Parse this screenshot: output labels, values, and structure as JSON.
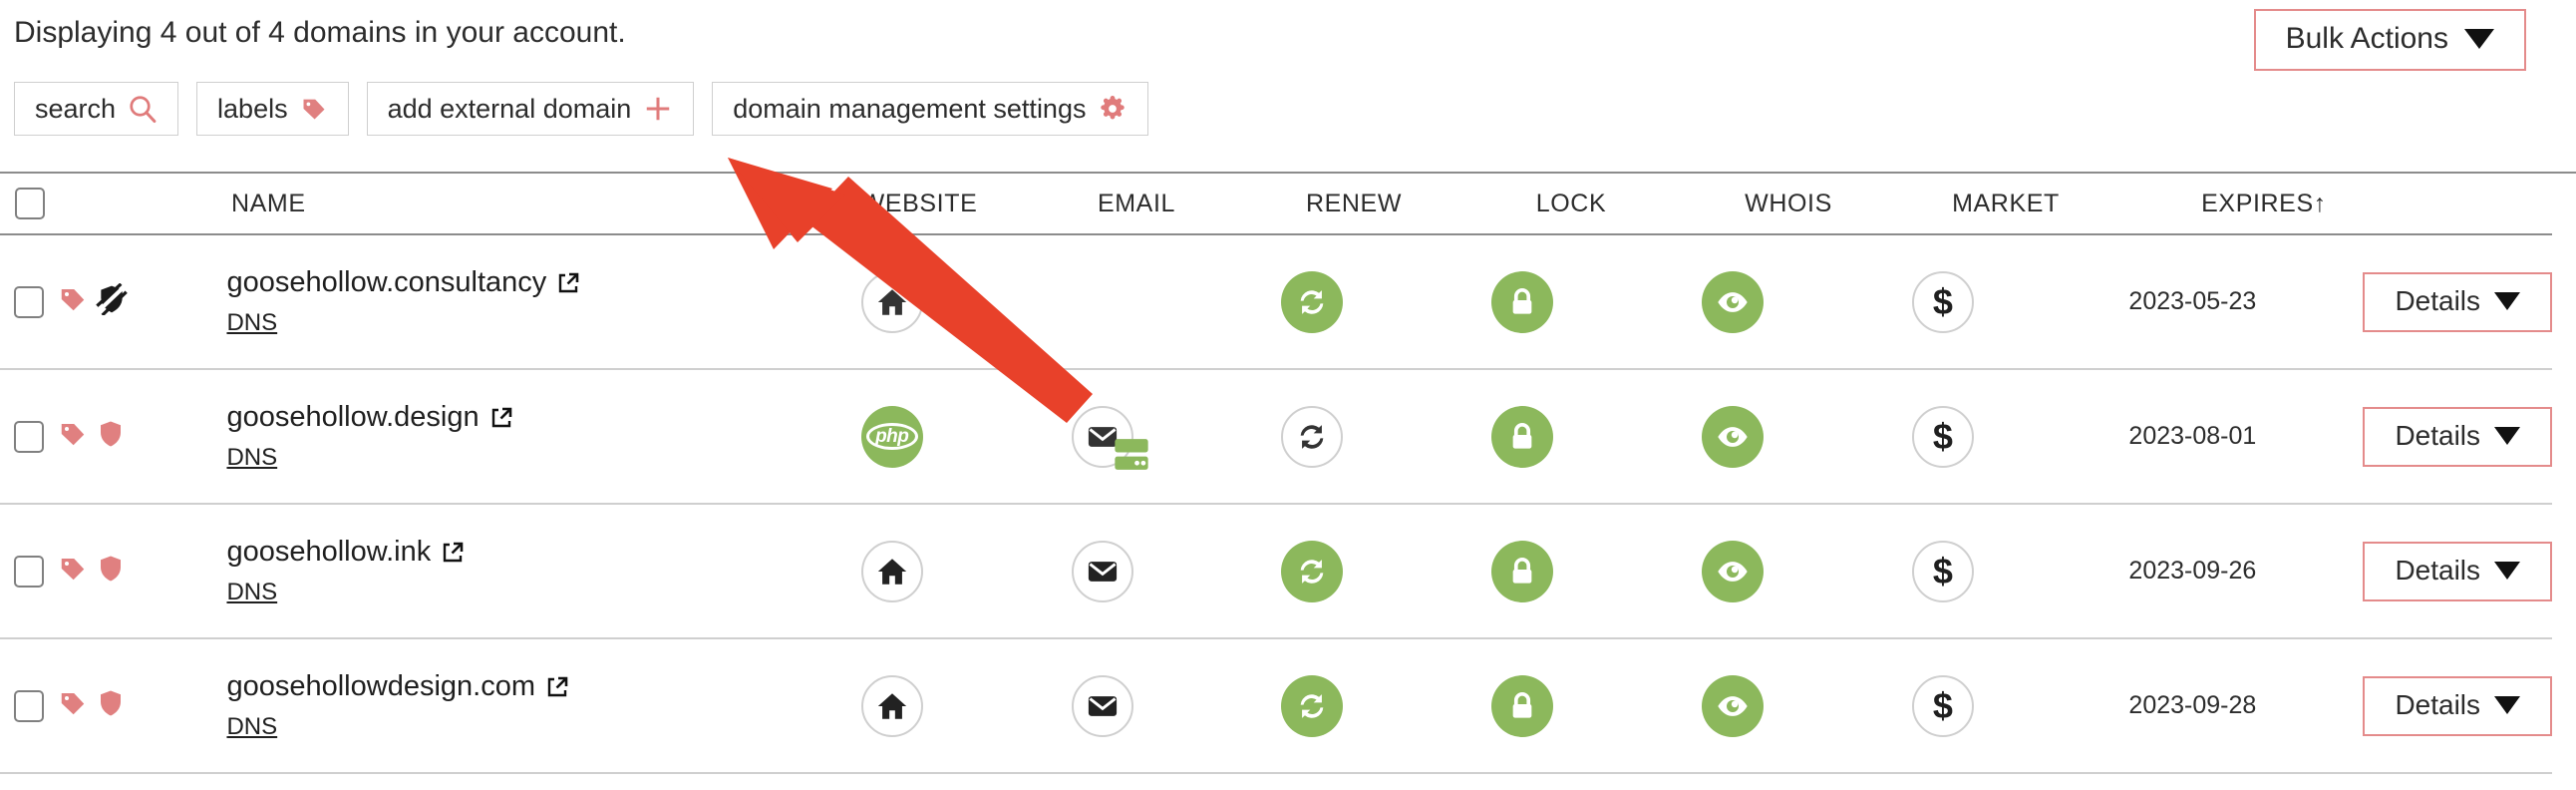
{
  "header": {
    "summary": "Displaying 4 out of 4 domains in your account.",
    "bulk_actions_label": "Bulk Actions",
    "bulk_actions_caret": "caret-down-icon"
  },
  "toolbar": {
    "buttons": [
      {
        "label": "search",
        "icon": "search-icon"
      },
      {
        "label": "labels",
        "icon": "tag-icon"
      },
      {
        "label": "add external domain",
        "icon": "plus-icon"
      },
      {
        "label": "domain management settings",
        "icon": "gear-icon"
      }
    ]
  },
  "table": {
    "columns": {
      "name": "NAME",
      "website": "WEBSITE",
      "email": "EMAIL",
      "renew": "RENEW",
      "lock": "LOCK",
      "whois": "WHOIS",
      "market": "MARKET",
      "expires": "EXPIRES",
      "expires_sort": "↑"
    },
    "dns_label": "DNS",
    "details_label": "Details",
    "rows": [
      {
        "name": "goosehollow.consultancy",
        "dns": "DNS",
        "labels": [
          "tag-icon",
          "shield-slash-icon"
        ],
        "website": {
          "icon": "house-icon",
          "state": "outline"
        },
        "email": {
          "icon": "none",
          "state": "none"
        },
        "renew": {
          "icon": "refresh-icon",
          "state": "green"
        },
        "lock": {
          "icon": "lock-icon",
          "state": "green"
        },
        "whois": {
          "icon": "eye-icon",
          "state": "green"
        },
        "market": {
          "icon": "dollar-icon",
          "state": "outline"
        },
        "expires": "2023-05-23",
        "details": "Details"
      },
      {
        "name": "goosehollow.design",
        "dns": "DNS",
        "labels": [
          "tag-icon",
          "shield-icon"
        ],
        "website": {
          "icon": "php-icon",
          "state": "green"
        },
        "email": {
          "icon": "envelope-icon",
          "state": "outline",
          "badge": "server-icon"
        },
        "renew": {
          "icon": "refresh-icon",
          "state": "outline"
        },
        "lock": {
          "icon": "lock-icon",
          "state": "green"
        },
        "whois": {
          "icon": "eye-icon",
          "state": "green"
        },
        "market": {
          "icon": "dollar-icon",
          "state": "outline"
        },
        "expires": "2023-08-01",
        "details": "Details"
      },
      {
        "name": "goosehollow.ink",
        "dns": "DNS",
        "labels": [
          "tag-icon",
          "shield-icon"
        ],
        "website": {
          "icon": "house-icon",
          "state": "outline"
        },
        "email": {
          "icon": "envelope-icon",
          "state": "outline"
        },
        "renew": {
          "icon": "refresh-icon",
          "state": "green"
        },
        "lock": {
          "icon": "lock-icon",
          "state": "green"
        },
        "whois": {
          "icon": "eye-icon",
          "state": "green"
        },
        "market": {
          "icon": "dollar-icon",
          "state": "outline"
        },
        "expires": "2023-09-26",
        "details": "Details"
      },
      {
        "name": "goosehollowdesign.com",
        "dns": "DNS",
        "labels": [
          "tag-icon",
          "shield-icon"
        ],
        "website": {
          "icon": "house-icon",
          "state": "outline"
        },
        "email": {
          "icon": "envelope-icon",
          "state": "outline"
        },
        "renew": {
          "icon": "refresh-icon",
          "state": "green"
        },
        "lock": {
          "icon": "lock-icon",
          "state": "green"
        },
        "whois": {
          "icon": "eye-icon",
          "state": "green"
        },
        "market": {
          "icon": "dollar-icon",
          "state": "outline"
        },
        "expires": "2023-09-28",
        "details": "Details"
      }
    ]
  },
  "annotation": {
    "type": "arrow",
    "color": "#e8412a",
    "points_to": "add external domain"
  },
  "colors": {
    "accent_red": "#e07b7b",
    "icon_red": "#e08080",
    "green": "#8cb85c",
    "arrow_red": "#e8412a",
    "text": "#2c2c2c"
  },
  "php_text": "php"
}
